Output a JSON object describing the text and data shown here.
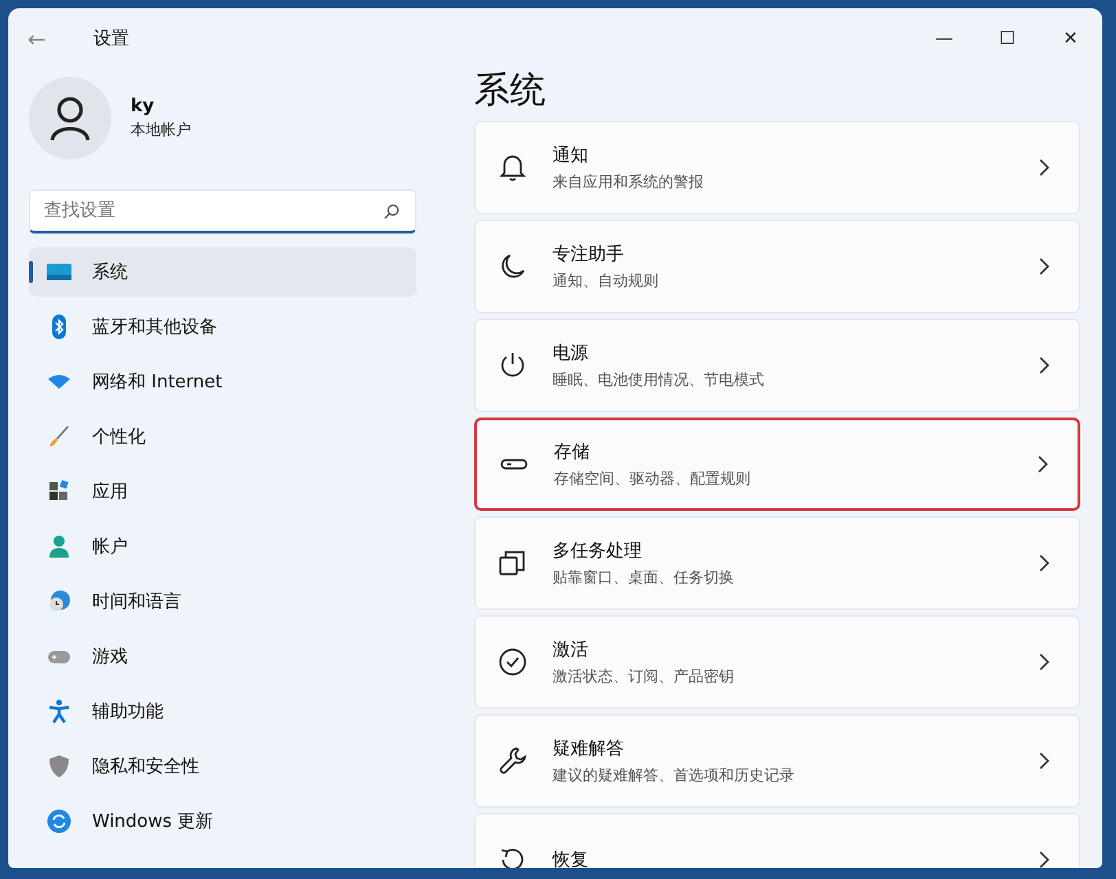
{
  "window": {
    "title": "设置",
    "back": "←",
    "controls": [
      "—",
      "☐",
      "✕"
    ]
  },
  "user": {
    "name": "ky",
    "account": "本地帐户"
  },
  "search": {
    "placeholder": "查找设置"
  },
  "nav": [
    {
      "label": "系统",
      "selected": true
    },
    {
      "label": "蓝牙和其他设备",
      "selected": false
    },
    {
      "label": "网络和 Internet",
      "selected": false
    },
    {
      "label": "个性化",
      "selected": false
    },
    {
      "label": "应用",
      "selected": false
    },
    {
      "label": "帐户",
      "selected": false
    },
    {
      "label": "时间和语言",
      "selected": false
    },
    {
      "label": "游戏",
      "selected": false
    },
    {
      "label": "辅助功能",
      "selected": false
    },
    {
      "label": "隐私和安全性",
      "selected": false
    },
    {
      "label": "Windows 更新",
      "selected": false
    }
  ],
  "page_title": "系统",
  "cards": [
    {
      "title": "通知",
      "subtitle": "来自应用和系统的警报",
      "highlighted": false
    },
    {
      "title": "专注助手",
      "subtitle": "通知、自动规则",
      "highlighted": false
    },
    {
      "title": "电源",
      "subtitle": "睡眠、电池使用情况、节电模式",
      "highlighted": false
    },
    {
      "title": "存储",
      "subtitle": "存储空间、驱动器、配置规则",
      "highlighted": true
    },
    {
      "title": "多任务处理",
      "subtitle": "贴靠窗口、桌面、任务切换",
      "highlighted": false
    },
    {
      "title": "激活",
      "subtitle": "激活状态、订阅、产品密钥",
      "highlighted": false
    },
    {
      "title": "疑难解答",
      "subtitle": "建议的疑难解答、首选项和历史记录",
      "highlighted": false
    },
    {
      "title": "恢复",
      "highlighted": false
    }
  ]
}
